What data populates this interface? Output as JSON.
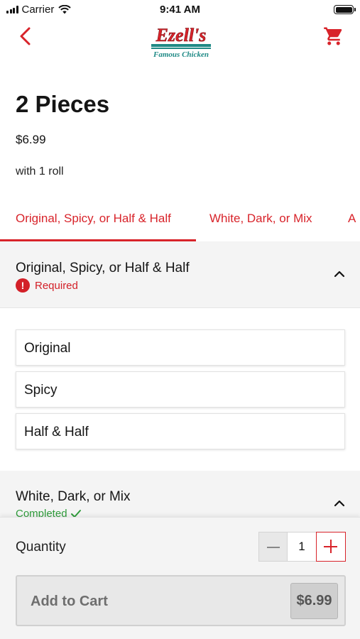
{
  "status_bar": {
    "carrier": "Carrier",
    "time": "9:41 AM"
  },
  "nav": {
    "back_icon": "chevron-left-icon",
    "logo_text": "Ezell's",
    "logo_subtext": "Famous Chicken",
    "cart_icon": "cart-icon",
    "accent_color": "#d8232a"
  },
  "product": {
    "title": "2 Pieces",
    "price": "$6.99",
    "description": "with 1 roll"
  },
  "tabs": [
    {
      "label": "Original, Spicy, or Half & Half",
      "active": true
    },
    {
      "label": "White, Dark, or Mix",
      "active": false
    },
    {
      "label": "A",
      "active": false
    }
  ],
  "sections": [
    {
      "title": "Original, Spicy, or Half & Half",
      "status": "Required",
      "status_icon": "alert-circle-icon",
      "expanded": true,
      "options": [
        "Original",
        "Spicy",
        "Half & Half"
      ]
    },
    {
      "title": "White, Dark, or Mix",
      "status": "Completed",
      "status_icon": "check-icon",
      "expanded": true
    }
  ],
  "footer": {
    "quantity_label": "Quantity",
    "quantity": "1",
    "add_to_cart_label": "Add to Cart",
    "add_to_cart_price": "$6.99"
  }
}
